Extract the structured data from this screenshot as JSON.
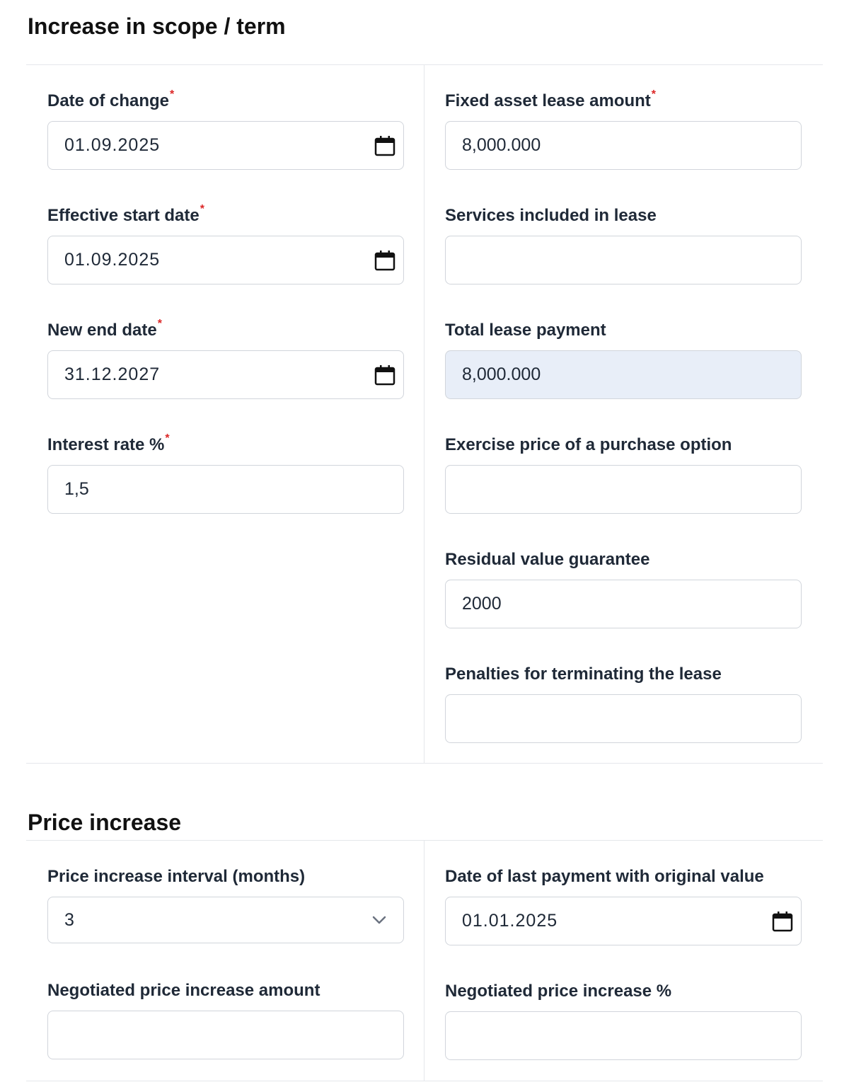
{
  "scope": {
    "title": "Increase in scope / term",
    "date_of_change": {
      "label": "Date of change",
      "required": "*",
      "value": "01.09.2025"
    },
    "effective_start_date": {
      "label": "Effective start date",
      "required": "*",
      "value": "01.09.2025"
    },
    "new_end_date": {
      "label": "New end date",
      "required": "*",
      "value": "31.12.2027"
    },
    "interest_rate": {
      "label": "Interest rate %",
      "required": "*",
      "value": "1,5"
    },
    "fixed_asset_lease_amount": {
      "label": "Fixed asset lease amount",
      "required": "*",
      "value": "8,000.000"
    },
    "services_included": {
      "label": "Services included in lease",
      "value": ""
    },
    "total_lease_payment": {
      "label": "Total lease payment",
      "value": "8,000.000"
    },
    "exercise_price": {
      "label": "Exercise price of a purchase option",
      "value": ""
    },
    "residual_value_guarantee": {
      "label": "Residual value guarantee",
      "value": "2000"
    },
    "penalties": {
      "label": "Penalties for terminating the lease",
      "value": ""
    }
  },
  "price_increase": {
    "title": "Price increase",
    "interval": {
      "label": "Price increase interval (months)",
      "value": "3"
    },
    "last_payment_date": {
      "label": "Date of last payment with original value",
      "value": "01.01.2025"
    },
    "negotiated_amount": {
      "label": "Negotiated price increase amount",
      "value": ""
    },
    "negotiated_percent": {
      "label": "Negotiated price increase %",
      "value": ""
    }
  },
  "icons": {
    "date_picker": "calendar-icon",
    "select": "chevron-down-icon"
  },
  "colors": {
    "required": "#dc2626",
    "readonly_bg": "#e8eef8",
    "border": "#d1d5db",
    "divider": "#e5e7eb"
  }
}
